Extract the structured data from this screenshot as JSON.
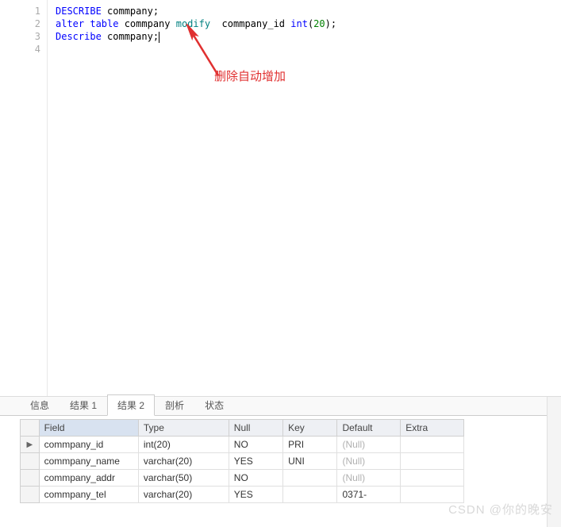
{
  "editor": {
    "lines": [
      {
        "num": "1",
        "tokens": [
          [
            "kw-blue",
            "DESCRIBE"
          ],
          [
            "ident",
            " commpany"
          ],
          [
            "punct",
            ";"
          ]
        ]
      },
      {
        "num": "2",
        "tokens": [
          [
            "kw-blue",
            "alter"
          ],
          [
            "ident",
            " "
          ],
          [
            "kw-blue",
            "table"
          ],
          [
            "ident",
            " commpany "
          ],
          [
            "kw-teal",
            "modify"
          ],
          [
            "ident",
            "  commpany_id "
          ],
          [
            "kw-blue",
            "int"
          ],
          [
            "punct",
            "("
          ],
          [
            "num",
            "20"
          ],
          [
            "punct",
            ");"
          ]
        ]
      },
      {
        "num": "3",
        "tokens": [
          [
            "kw-blue",
            "Describe"
          ],
          [
            "ident",
            " commpany"
          ],
          [
            "punct",
            ";"
          ]
        ],
        "cursor": true
      },
      {
        "num": "4",
        "tokens": []
      }
    ]
  },
  "annotation_text": "删除自动增加",
  "tabs": {
    "items": [
      {
        "label": "信息",
        "active": false
      },
      {
        "label": "结果 1",
        "active": false
      },
      {
        "label": "结果 2",
        "active": true
      },
      {
        "label": "剖析",
        "active": false
      },
      {
        "label": "状态",
        "active": false
      }
    ]
  },
  "grid": {
    "headers": [
      "Field",
      "Type",
      "Null",
      "Key",
      "Default",
      "Extra"
    ],
    "selected_header_index": 0,
    "rows": [
      {
        "marker": "▶",
        "cells": [
          "commpany_id",
          "int(20)",
          "NO",
          "PRI",
          "(Null)",
          ""
        ]
      },
      {
        "marker": "",
        "cells": [
          "commpany_name",
          "varchar(20)",
          "YES",
          "UNI",
          "(Null)",
          ""
        ]
      },
      {
        "marker": "",
        "cells": [
          "commpany_addr",
          "varchar(50)",
          "NO",
          "",
          "(Null)",
          ""
        ]
      },
      {
        "marker": "",
        "cells": [
          "commpany_tel",
          "varchar(20)",
          "YES",
          "",
          "0371-",
          ""
        ]
      }
    ]
  },
  "watermark": "CSDN @你的晚安"
}
